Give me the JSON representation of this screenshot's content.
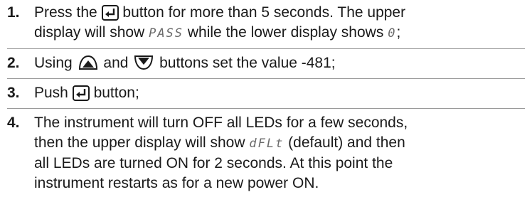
{
  "steps": [
    {
      "number": "1.",
      "line1_a": "Press the",
      "line1_b": "button for more than 5 seconds.  The upper",
      "line2_a": "display will show",
      "seg_pass": "PASS",
      "line2_b": "while the lower display shows",
      "seg_zero": "0",
      "line2_c": ";"
    },
    {
      "number": "2.",
      "text_a": "Using",
      "text_b": "and",
      "text_c": "buttons set the value -481;"
    },
    {
      "number": "3.",
      "text_a": "Push",
      "text_b": "button;"
    },
    {
      "number": "4.",
      "line1": "The instrument will turn OFF all LEDs for a few seconds,",
      "line2_a": "then the upper display will show",
      "seg_dflt": "dFLt",
      "line2_b": "(default) and then",
      "line3": "all LEDs are turned ON for 2 seconds. At this point the",
      "line4": "instrument restarts as for a new power ON."
    }
  ],
  "icons": {
    "enter": "enter-key-icon",
    "up": "up-arrow-key-icon",
    "down": "down-arrow-key-icon"
  }
}
